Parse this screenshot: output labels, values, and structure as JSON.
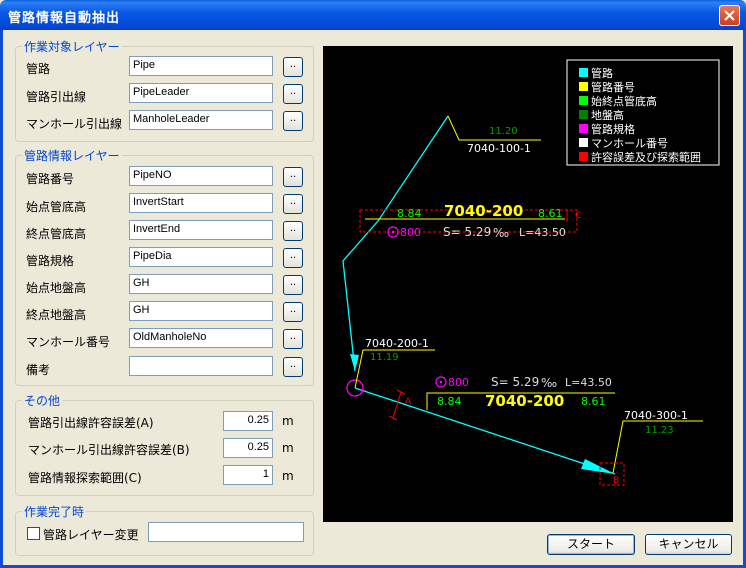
{
  "window": {
    "title": "管路情報自動抽出"
  },
  "group_target": {
    "legend": "作業対象レイヤー",
    "rows": [
      {
        "label": "管路",
        "value": "Pipe"
      },
      {
        "label": "管路引出線",
        "value": "PipeLeader"
      },
      {
        "label": "マンホール引出線",
        "value": "ManholeLeader"
      }
    ]
  },
  "group_info": {
    "legend": "管路情報レイヤー",
    "rows": [
      {
        "label": "管路番号",
        "value": "PipeNO"
      },
      {
        "label": "始点管底高",
        "value": "InvertStart"
      },
      {
        "label": "終点管底高",
        "value": "InvertEnd"
      },
      {
        "label": "管路規格",
        "value": "PipeDia"
      },
      {
        "label": "始点地盤高",
        "value": "GH"
      },
      {
        "label": "終点地盤高",
        "value": "GH"
      },
      {
        "label": "マンホール番号",
        "value": "OldManholeNo"
      },
      {
        "label": "備考",
        "value": ""
      }
    ]
  },
  "browse_label": "..",
  "group_other": {
    "legend": "その他",
    "rows": [
      {
        "label": "管路引出線許容誤差(A)",
        "value": "0.25",
        "unit": "m"
      },
      {
        "label": "マンホール引出線許容誤差(B)",
        "value": "0.25",
        "unit": "m"
      },
      {
        "label": "管路情報探索範囲(C)",
        "value": "1",
        "unit": "m"
      }
    ]
  },
  "group_done": {
    "legend": "作業完了時",
    "checkbox_label": "管路レイヤー変更",
    "checked": false,
    "text_value": ""
  },
  "preview": {
    "legend_items": [
      {
        "label": "管路",
        "color": "#00ffff"
      },
      {
        "label": "管路番号",
        "color": "#ffff00"
      },
      {
        "label": "始終点管底高",
        "color": "#00ff00"
      },
      {
        "label": "地盤高",
        "color": "#008000"
      },
      {
        "label": "管路規格",
        "color": "#ff00ff"
      },
      {
        "label": "マンホール番号",
        "color": "#ffffff"
      },
      {
        "label": "許容誤差及び探索範囲",
        "color": "#ff0000"
      }
    ],
    "labels": {
      "mh_top": "7040-100-1",
      "gh_top": "11.20",
      "pipe1_no": "7040-200",
      "pipe1_inv_start": "8.84",
      "pipe1_inv_end": "8.61",
      "pipe1_dia": "800",
      "pipe1_slope": "S= 5.29",
      "pipe1_slope_unit": "‰",
      "pipe1_len": "L=43.50",
      "mark_c": "C",
      "mh_mid": "7040-200-1",
      "gh_mid": "11.19",
      "pipe2_dia": "800",
      "pipe2_slope": "S= 5.29",
      "pipe2_slope_unit": "‰",
      "pipe2_len": "L=43.50",
      "pipe2_no": "7040-200",
      "pipe2_inv_start": "8.84",
      "pipe2_inv_end": "8.61",
      "mark_a": "A",
      "mh_end": "7040-300-1",
      "gh_end": "11.23",
      "mark_b": "B"
    }
  },
  "buttons": {
    "start": "スタート",
    "cancel": "キャンセル"
  }
}
